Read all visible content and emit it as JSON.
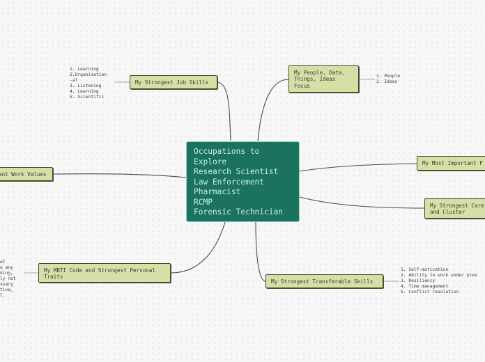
{
  "central": {
    "lines": [
      "Occupations to",
      "Explore",
      "Research Scientist",
      "Law Enforcement",
      "Pharmacist",
      "RCMP",
      "Forensic Technician"
    ]
  },
  "nodes": {
    "job_skills": "My Strongest Job Skills",
    "people_data_line1": "My People, Data,",
    "people_data_line2": "Things, Ideas",
    "people_data_line3": "Focus",
    "important": "My Most Important F",
    "career_line1": "My Strongest Care",
    "career_line2": "and Cluster",
    "transferable": "My Strongest Transferable Skills",
    "mbti_line1": "My MBTI Code and Strongest Personal",
    "mbti_line2": "Traits",
    "work_values": "ant Work Values"
  },
  "notes": {
    "job_skills": [
      "1. Learning",
      "2.Organisation",
      "-al",
      "3. Listening",
      "4. Learning",
      "5. Scientific"
    ],
    "people_data": [
      "1. People",
      "2. Ideas"
    ],
    "transferable": [
      "1. Self-motivation",
      "2. Ability to work under pres",
      "3. Resiliency",
      "4. Time management",
      "5. Conflict resolution"
    ],
    "mbti": [
      "et",
      "o any",
      "king,",
      "ly not",
      "ssary",
      "tive,",
      "l."
    ]
  }
}
